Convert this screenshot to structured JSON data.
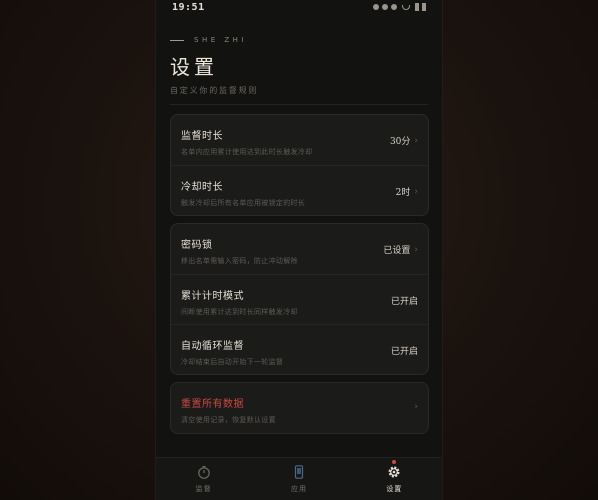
{
  "status_bar": {
    "time": "19:51"
  },
  "header": {
    "kicker": "SHE ZHI",
    "title": "设置",
    "subtitle": "自定义你的监督规则"
  },
  "groups": [
    {
      "rows": [
        {
          "title": "监督时长",
          "desc": "名单内应用累计使用达到此时长触发冷却",
          "value": "30分"
        },
        {
          "title": "冷却时长",
          "desc": "触发冷却后所有名单应用被锁定的时长",
          "value": "2时"
        }
      ]
    },
    {
      "rows": [
        {
          "title": "密码锁",
          "desc": "移出名单需输入密码，防止冲动解除",
          "value": "已设置"
        },
        {
          "title": "累计计时模式",
          "desc": "间断使用累计达到时长同样触发冷却",
          "value": "已开启"
        },
        {
          "title": "自动循环监督",
          "desc": "冷却结束后自动开始下一轮监督",
          "value": "已开启"
        }
      ]
    },
    {
      "rows": [
        {
          "title": "重置所有数据",
          "desc": "清空使用记录，恢复默认设置",
          "value": ""
        }
      ]
    }
  ],
  "tabs": [
    {
      "label": "监督",
      "icon": "timer-icon"
    },
    {
      "label": "应用",
      "icon": "phone-icon"
    },
    {
      "label": "设置",
      "icon": "gear-icon"
    }
  ],
  "colors": {
    "accent_red": "#c9493d",
    "background": "#121211",
    "card": "#1b1b1a"
  }
}
